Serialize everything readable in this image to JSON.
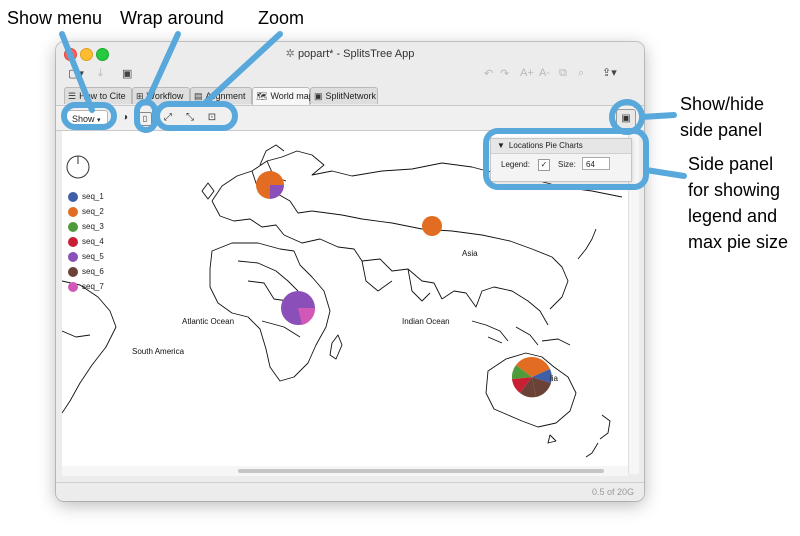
{
  "annotations": {
    "show_menu": "Show menu",
    "wrap_around": "Wrap around",
    "zoom": "Zoom",
    "show_hide": [
      "Show/hide",
      "side panel"
    ],
    "side_panel": [
      "Side panel",
      "for showing",
      "legend and",
      "max pie size"
    ]
  },
  "window": {
    "title": "popart* - SplitsTree App",
    "tabs": [
      {
        "label": "How to Cite",
        "icon": "lines-icon"
      },
      {
        "label": "Workflow",
        "icon": "workflow-icon"
      },
      {
        "label": "Alignment",
        "icon": "alignment-icon"
      },
      {
        "label": "World map",
        "icon": "map-icon",
        "active": true
      },
      {
        "label": "SplitNetwork",
        "icon": "network-icon"
      }
    ],
    "show_button": "Show",
    "status": "0.5 of 20G"
  },
  "panel": {
    "title": "Locations Pie Charts",
    "legend_label": "Legend:",
    "legend_checked": "✓",
    "size_label": "Size:",
    "size_value": "64"
  },
  "legend": [
    {
      "label": "seq_1",
      "color": "#3f5ea8"
    },
    {
      "label": "seq_2",
      "color": "#e26c22"
    },
    {
      "label": "seq_3",
      "color": "#4f9a3a"
    },
    {
      "label": "seq_4",
      "color": "#c81f34"
    },
    {
      "label": "seq_5",
      "color": "#8a4fb8"
    },
    {
      "label": "seq_6",
      "color": "#6a4336"
    },
    {
      "label": "seq_7",
      "color": "#d258b8"
    }
  ],
  "map_labels": {
    "asia": "Asia",
    "atlantic": "Atlantic Ocean",
    "indian": "Indian Ocean",
    "south_america": "South America",
    "australia": "lia"
  }
}
